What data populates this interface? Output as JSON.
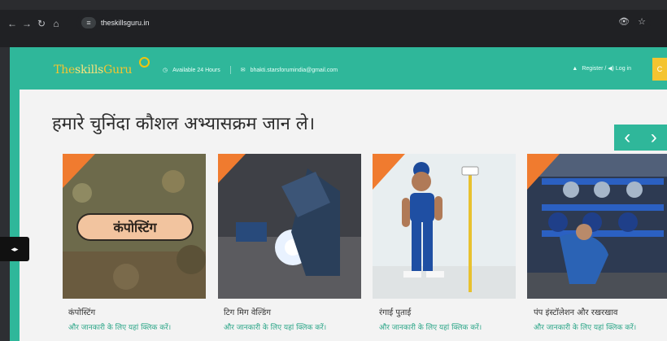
{
  "browser": {
    "url": "theskillsguru.in",
    "nav_icons": [
      "back-icon",
      "forward-icon",
      "reload-icon",
      "home-icon"
    ],
    "right_icons": [
      "eye-off-icon",
      "star-icon"
    ]
  },
  "topbar": {
    "logo_left": "The",
    "logo_mid": "skills",
    "logo_right": "Guru",
    "availability": "Available 24 Hours",
    "email": "bhakti.starsforumindia@gmail.com",
    "auth": "Register / ◀) Log in",
    "accent_colors": {
      "teal": "#2fb79a",
      "yellow": "#f4c430"
    }
  },
  "main": {
    "heading": "हमारे चुनिंदा कौशल अभ्यासक्रम जान ले।",
    "arrows": {
      "prev": "‹",
      "next": "›"
    },
    "courses": [
      {
        "title": "कंपोस्टिंग",
        "link": "और जानकारी के लिए यहां क्लिक करें।",
        "badge": "कंपोस्टिंग"
      },
      {
        "title": "टिग मिग वेल्डिंग",
        "link": "और जानकारी के लिए यहां क्लिक करें।"
      },
      {
        "title": "रंगाई पुताई",
        "link": "और जानकारी के लिए यहां क्लिक करें।"
      },
      {
        "title": "पंप इंस्टॉलेशन और रखरखाव",
        "link": "और जानकारी के लिए यहां क्लिक करें।"
      }
    ]
  }
}
